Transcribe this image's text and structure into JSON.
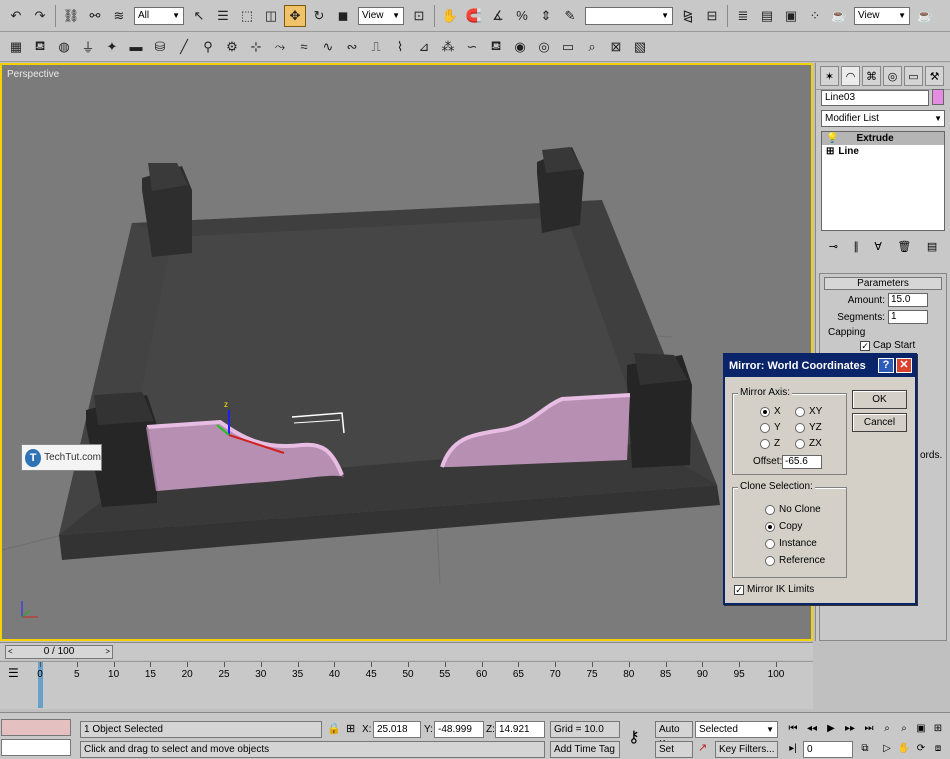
{
  "toolbar": {
    "selection_filter": "All",
    "ref_coord_1": "View",
    "named_selection": "",
    "ref_coord_2": "View"
  },
  "viewport": {
    "label": "Perspective",
    "watermark": "TechTut.com"
  },
  "command_panel": {
    "object_name": "Line03",
    "modifier_list": "Modifier List",
    "stack": [
      "Extrude",
      "Line"
    ],
    "rollout_title": "Parameters",
    "amount_label": "Amount:",
    "amount_value": "15.0",
    "segments_label": "Segments:",
    "segments_value": "1",
    "capping_label": "Capping",
    "cap_start_label": "Cap Start",
    "peek_text": "ords."
  },
  "dialog": {
    "title": "Mirror: World Coordinates",
    "mirror_axis_label": "Mirror Axis:",
    "axis_options": [
      "X",
      "Y",
      "Z",
      "XY",
      "YZ",
      "ZX"
    ],
    "axis_selected": "X",
    "offset_label": "Offset:",
    "offset_value": "-65.6",
    "clone_label": "Clone Selection:",
    "clone_options": [
      "No Clone",
      "Copy",
      "Instance",
      "Reference"
    ],
    "clone_selected": "Copy",
    "mirror_ik_label": "Mirror IK Limits",
    "ok_label": "OK",
    "cancel_label": "Cancel"
  },
  "timeline": {
    "slider_text": "0 / 100",
    "ticks": [
      "0",
      "5",
      "10",
      "15",
      "20",
      "25",
      "30",
      "35",
      "40",
      "45",
      "50",
      "55",
      "60",
      "65",
      "70",
      "75",
      "80",
      "85",
      "90",
      "95",
      "100"
    ]
  },
  "status": {
    "selected_count": "1 Object Selected",
    "prompt": "Click and drag to select and move objects",
    "x_label": "X:",
    "x_value": "25.018",
    "y_label": "Y:",
    "y_value": "-48.999",
    "z_label": "Z:",
    "z_value": "14.921",
    "grid": "Grid = 10.0",
    "add_time_tag": "Add Time Tag",
    "auto_key": "Auto Key",
    "set_key": "Set Key",
    "key_mode": "Selected",
    "key_filters": "Key Filters...",
    "frame": "0"
  }
}
